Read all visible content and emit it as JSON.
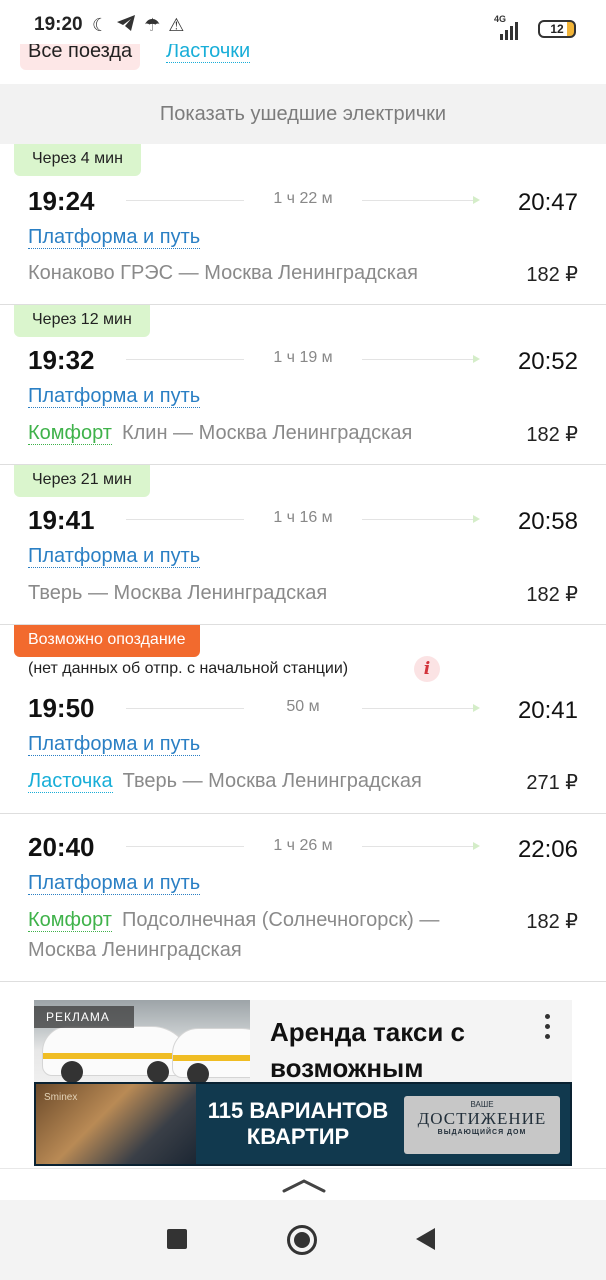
{
  "status_bar": {
    "time": "19:20",
    "network": "4G",
    "battery": "12"
  },
  "filters": {
    "all_trains": "Все поезда",
    "swallow": "Ласточки"
  },
  "show_departed": "Показать ушедшие электрички",
  "trains": [
    {
      "badge": "Через 4 мин",
      "departure": "19:24",
      "duration": "1 ч 22 м",
      "arrival": "20:47",
      "platform": "Платформа и путь",
      "train_class": "",
      "route": "Конаково ГРЭС — Москва Ленинградская",
      "price": "182 ₽"
    },
    {
      "badge": "Через 12 мин",
      "departure": "19:32",
      "duration": "1 ч 19 м",
      "arrival": "20:52",
      "platform": "Платформа и путь",
      "train_class": "Комфорт",
      "route": "Клин — Москва Ленинградская",
      "price": "182 ₽"
    },
    {
      "badge": "Через 21 мин",
      "departure": "19:41",
      "duration": "1 ч 16 м",
      "arrival": "20:58",
      "platform": "Платформа и путь",
      "train_class": "",
      "route": "Тверь — Москва Ленинградская",
      "price": "182 ₽"
    },
    {
      "badge": "Возможно опоздание",
      "note": "(нет данных об отпр. с начальной станции)",
      "departure": "19:50",
      "duration": "50 м",
      "arrival": "20:41",
      "platform": "Платформа и путь",
      "train_class": "Ласточка",
      "route": "Тверь — Москва Ленинградская",
      "price": "271 ₽"
    },
    {
      "badge": "",
      "departure": "20:40",
      "duration": "1 ч 26 м",
      "arrival": "22:06",
      "platform": "Платформа и путь",
      "train_class": "Комфорт",
      "route": "Подсолнечная (Солнечногорск) — Москва Ленинградская",
      "price": "182 ₽"
    }
  ],
  "ad": {
    "label": "РЕКЛАМА",
    "title": "Аренда такси с возможным",
    "banner_brand": "Sminex",
    "banner_headline": "115 ВАРИАНТОВ КВАРТИР",
    "banner_logo_top": "ВАШЕ",
    "banner_logo_main": "ДОСТИЖЕНИЕ",
    "banner_logo_sub": "ВЫДАЮЩИЙСЯ ДОМ"
  },
  "colors": {
    "accent_blue": "#2a7fc4",
    "swallow_cyan": "#18aed8",
    "comfort_green": "#3fb24a",
    "badge_green": "#daf5cd",
    "badge_orange": "#f26a2e"
  }
}
